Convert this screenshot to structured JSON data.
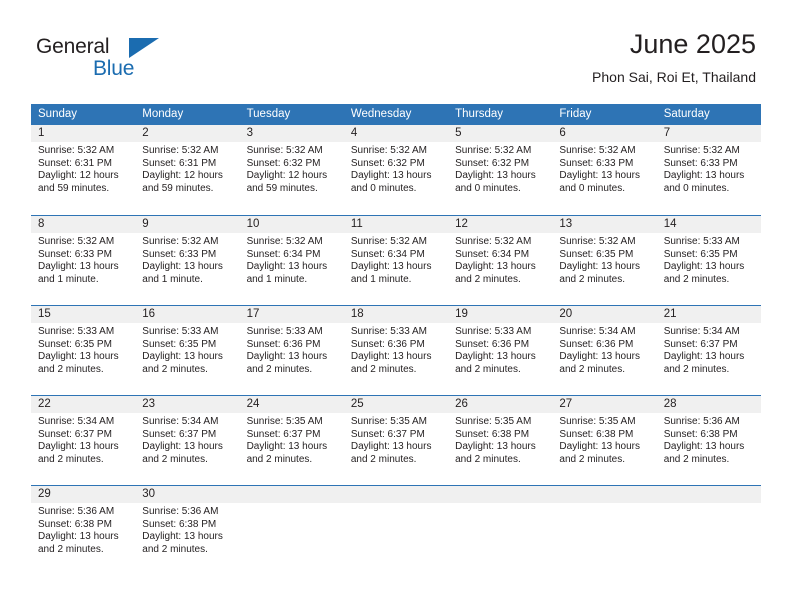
{
  "brand": {
    "name_part1": "General",
    "name_part2": "Blue",
    "accent_color": "#1b6cb0"
  },
  "header": {
    "title": "June 2025",
    "subtitle": "Phon Sai, Roi Et, Thailand"
  },
  "colors": {
    "header_blue": "#2e74b5",
    "daynum_band": "#f0f0f0",
    "text": "#231f20"
  },
  "weekdays": [
    "Sunday",
    "Monday",
    "Tuesday",
    "Wednesday",
    "Thursday",
    "Friday",
    "Saturday"
  ],
  "labels": {
    "sunrise_prefix": "Sunrise:",
    "sunset_prefix": "Sunset:",
    "daylight_prefix": "Daylight:"
  },
  "weeks": [
    [
      {
        "day": "1",
        "sunrise": "Sunrise: 5:32 AM",
        "sunset": "Sunset: 6:31 PM",
        "daylight_line1": "Daylight: 12 hours",
        "daylight_line2": "and 59 minutes."
      },
      {
        "day": "2",
        "sunrise": "Sunrise: 5:32 AM",
        "sunset": "Sunset: 6:31 PM",
        "daylight_line1": "Daylight: 12 hours",
        "daylight_line2": "and 59 minutes."
      },
      {
        "day": "3",
        "sunrise": "Sunrise: 5:32 AM",
        "sunset": "Sunset: 6:32 PM",
        "daylight_line1": "Daylight: 12 hours",
        "daylight_line2": "and 59 minutes."
      },
      {
        "day": "4",
        "sunrise": "Sunrise: 5:32 AM",
        "sunset": "Sunset: 6:32 PM",
        "daylight_line1": "Daylight: 13 hours",
        "daylight_line2": "and 0 minutes."
      },
      {
        "day": "5",
        "sunrise": "Sunrise: 5:32 AM",
        "sunset": "Sunset: 6:32 PM",
        "daylight_line1": "Daylight: 13 hours",
        "daylight_line2": "and 0 minutes."
      },
      {
        "day": "6",
        "sunrise": "Sunrise: 5:32 AM",
        "sunset": "Sunset: 6:33 PM",
        "daylight_line1": "Daylight: 13 hours",
        "daylight_line2": "and 0 minutes."
      },
      {
        "day": "7",
        "sunrise": "Sunrise: 5:32 AM",
        "sunset": "Sunset: 6:33 PM",
        "daylight_line1": "Daylight: 13 hours",
        "daylight_line2": "and 0 minutes."
      }
    ],
    [
      {
        "day": "8",
        "sunrise": "Sunrise: 5:32 AM",
        "sunset": "Sunset: 6:33 PM",
        "daylight_line1": "Daylight: 13 hours",
        "daylight_line2": "and 1 minute."
      },
      {
        "day": "9",
        "sunrise": "Sunrise: 5:32 AM",
        "sunset": "Sunset: 6:33 PM",
        "daylight_line1": "Daylight: 13 hours",
        "daylight_line2": "and 1 minute."
      },
      {
        "day": "10",
        "sunrise": "Sunrise: 5:32 AM",
        "sunset": "Sunset: 6:34 PM",
        "daylight_line1": "Daylight: 13 hours",
        "daylight_line2": "and 1 minute."
      },
      {
        "day": "11",
        "sunrise": "Sunrise: 5:32 AM",
        "sunset": "Sunset: 6:34 PM",
        "daylight_line1": "Daylight: 13 hours",
        "daylight_line2": "and 1 minute."
      },
      {
        "day": "12",
        "sunrise": "Sunrise: 5:32 AM",
        "sunset": "Sunset: 6:34 PM",
        "daylight_line1": "Daylight: 13 hours",
        "daylight_line2": "and 2 minutes."
      },
      {
        "day": "13",
        "sunrise": "Sunrise: 5:32 AM",
        "sunset": "Sunset: 6:35 PM",
        "daylight_line1": "Daylight: 13 hours",
        "daylight_line2": "and 2 minutes."
      },
      {
        "day": "14",
        "sunrise": "Sunrise: 5:33 AM",
        "sunset": "Sunset: 6:35 PM",
        "daylight_line1": "Daylight: 13 hours",
        "daylight_line2": "and 2 minutes."
      }
    ],
    [
      {
        "day": "15",
        "sunrise": "Sunrise: 5:33 AM",
        "sunset": "Sunset: 6:35 PM",
        "daylight_line1": "Daylight: 13 hours",
        "daylight_line2": "and 2 minutes."
      },
      {
        "day": "16",
        "sunrise": "Sunrise: 5:33 AM",
        "sunset": "Sunset: 6:35 PM",
        "daylight_line1": "Daylight: 13 hours",
        "daylight_line2": "and 2 minutes."
      },
      {
        "day": "17",
        "sunrise": "Sunrise: 5:33 AM",
        "sunset": "Sunset: 6:36 PM",
        "daylight_line1": "Daylight: 13 hours",
        "daylight_line2": "and 2 minutes."
      },
      {
        "day": "18",
        "sunrise": "Sunrise: 5:33 AM",
        "sunset": "Sunset: 6:36 PM",
        "daylight_line1": "Daylight: 13 hours",
        "daylight_line2": "and 2 minutes."
      },
      {
        "day": "19",
        "sunrise": "Sunrise: 5:33 AM",
        "sunset": "Sunset: 6:36 PM",
        "daylight_line1": "Daylight: 13 hours",
        "daylight_line2": "and 2 minutes."
      },
      {
        "day": "20",
        "sunrise": "Sunrise: 5:34 AM",
        "sunset": "Sunset: 6:36 PM",
        "daylight_line1": "Daylight: 13 hours",
        "daylight_line2": "and 2 minutes."
      },
      {
        "day": "21",
        "sunrise": "Sunrise: 5:34 AM",
        "sunset": "Sunset: 6:37 PM",
        "daylight_line1": "Daylight: 13 hours",
        "daylight_line2": "and 2 minutes."
      }
    ],
    [
      {
        "day": "22",
        "sunrise": "Sunrise: 5:34 AM",
        "sunset": "Sunset: 6:37 PM",
        "daylight_line1": "Daylight: 13 hours",
        "daylight_line2": "and 2 minutes."
      },
      {
        "day": "23",
        "sunrise": "Sunrise: 5:34 AM",
        "sunset": "Sunset: 6:37 PM",
        "daylight_line1": "Daylight: 13 hours",
        "daylight_line2": "and 2 minutes."
      },
      {
        "day": "24",
        "sunrise": "Sunrise: 5:35 AM",
        "sunset": "Sunset: 6:37 PM",
        "daylight_line1": "Daylight: 13 hours",
        "daylight_line2": "and 2 minutes."
      },
      {
        "day": "25",
        "sunrise": "Sunrise: 5:35 AM",
        "sunset": "Sunset: 6:37 PM",
        "daylight_line1": "Daylight: 13 hours",
        "daylight_line2": "and 2 minutes."
      },
      {
        "day": "26",
        "sunrise": "Sunrise: 5:35 AM",
        "sunset": "Sunset: 6:38 PM",
        "daylight_line1": "Daylight: 13 hours",
        "daylight_line2": "and 2 minutes."
      },
      {
        "day": "27",
        "sunrise": "Sunrise: 5:35 AM",
        "sunset": "Sunset: 6:38 PM",
        "daylight_line1": "Daylight: 13 hours",
        "daylight_line2": "and 2 minutes."
      },
      {
        "day": "28",
        "sunrise": "Sunrise: 5:36 AM",
        "sunset": "Sunset: 6:38 PM",
        "daylight_line1": "Daylight: 13 hours",
        "daylight_line2": "and 2 minutes."
      }
    ],
    [
      {
        "day": "29",
        "sunrise": "Sunrise: 5:36 AM",
        "sunset": "Sunset: 6:38 PM",
        "daylight_line1": "Daylight: 13 hours",
        "daylight_line2": "and 2 minutes."
      },
      {
        "day": "30",
        "sunrise": "Sunrise: 5:36 AM",
        "sunset": "Sunset: 6:38 PM",
        "daylight_line1": "Daylight: 13 hours",
        "daylight_line2": "and 2 minutes."
      },
      {
        "day": "",
        "sunrise": "",
        "sunset": "",
        "daylight_line1": "",
        "daylight_line2": ""
      },
      {
        "day": "",
        "sunrise": "",
        "sunset": "",
        "daylight_line1": "",
        "daylight_line2": ""
      },
      {
        "day": "",
        "sunrise": "",
        "sunset": "",
        "daylight_line1": "",
        "daylight_line2": ""
      },
      {
        "day": "",
        "sunrise": "",
        "sunset": "",
        "daylight_line1": "",
        "daylight_line2": ""
      },
      {
        "day": "",
        "sunrise": "",
        "sunset": "",
        "daylight_line1": "",
        "daylight_line2": ""
      }
    ]
  ]
}
